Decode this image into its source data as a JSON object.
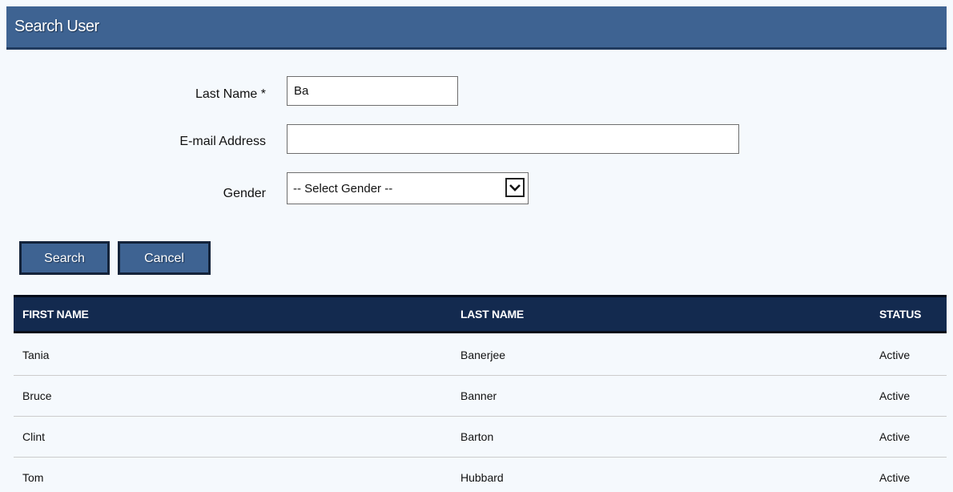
{
  "header": {
    "title": "Search User"
  },
  "form": {
    "last_name_label": "Last Name *",
    "last_name_value": "Ba",
    "email_label": "E-mail Address",
    "email_value": "",
    "gender_label": "Gender",
    "gender_selected": "-- Select Gender --"
  },
  "buttons": {
    "search_label": "Search",
    "cancel_label": "Cancel"
  },
  "table": {
    "columns": [
      "FIRST NAME",
      "LAST NAME",
      "STATUS"
    ],
    "rows": [
      [
        "Tania",
        "Banerjee",
        "Active"
      ],
      [
        "Bruce",
        "Banner",
        "Active"
      ],
      [
        "Clint",
        "Barton",
        "Active"
      ],
      [
        "Tom",
        "Hubbard",
        "Active"
      ]
    ]
  },
  "colors": {
    "header_bg": "#3e6392",
    "table_header_bg": "#132a4f",
    "page_bg": "#f5f9fd"
  },
  "icons": {
    "gender_dropdown": "chevron-down-icon"
  }
}
